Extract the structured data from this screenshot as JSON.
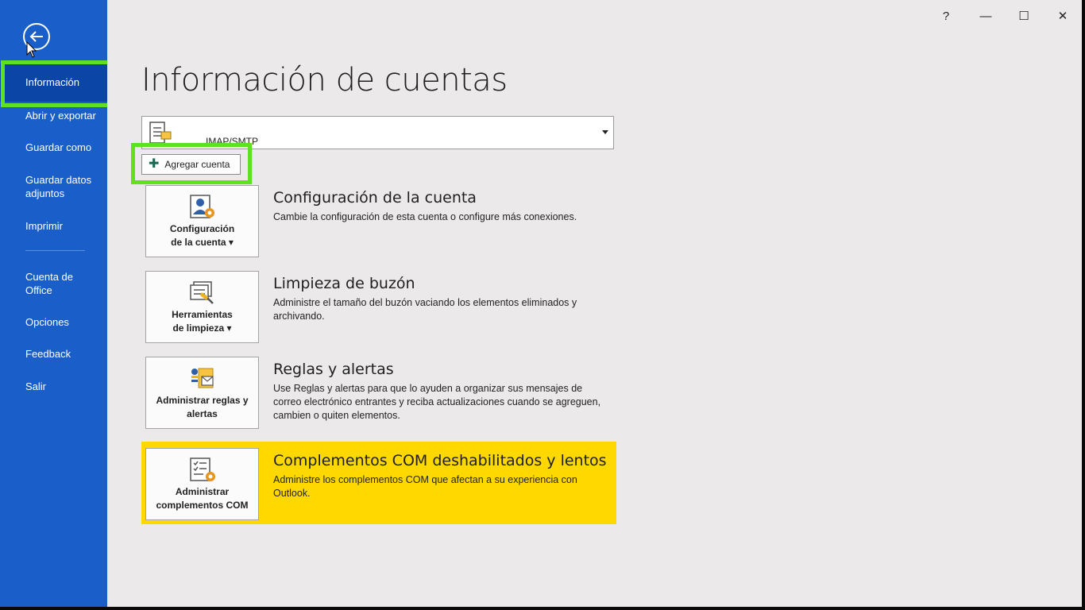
{
  "window": {
    "help_label": "?",
    "minimize_label": "—",
    "maximize_label": "☐",
    "close_label": "✕"
  },
  "sidebar": {
    "items": [
      {
        "label": "Información"
      },
      {
        "label": "Abrir y exportar"
      },
      {
        "label": "Guardar como"
      },
      {
        "label": "Guardar datos adjuntos"
      },
      {
        "label": "Imprimir"
      },
      {
        "label": "Cuenta de Office"
      },
      {
        "label": "Opciones"
      },
      {
        "label": "Feedback"
      },
      {
        "label": "Salir"
      }
    ]
  },
  "main": {
    "title": "Información de cuentas",
    "account_value": "IMAP/SMTP",
    "add_account_label": "Agregar cuenta",
    "sections": [
      {
        "tile_line1": "Configuración",
        "tile_line2": "de la cuenta ▾",
        "title": "Configuración de la cuenta",
        "description": "Cambie la configuración de esta cuenta o configure más conexiones."
      },
      {
        "tile_line1": "Herramientas",
        "tile_line2": "de limpieza ▾",
        "title": "Limpieza de buzón",
        "description": "Administre el tamaño del buzón vaciando los elementos eliminados y archivando."
      },
      {
        "tile_line1": "Administrar reglas y",
        "tile_line2": "alertas",
        "title": "Reglas y alertas",
        "description": "Use Reglas y alertas para que lo ayuden a organizar sus mensajes de correo electrónico entrantes y reciba actualizaciones cuando se agreguen, cambien o quiten elementos."
      },
      {
        "tile_line1": "Administrar",
        "tile_line2": "complementos COM",
        "title": "Complementos COM deshabilitados y lentos",
        "description": "Administre los complementos COM que afectan a su experiencia con Outlook."
      }
    ]
  },
  "colors": {
    "sidebar": "#1a5fc9",
    "sidebar_active": "#0b46a7",
    "highlight": "#5ee11f",
    "warning": "#ffd800"
  }
}
